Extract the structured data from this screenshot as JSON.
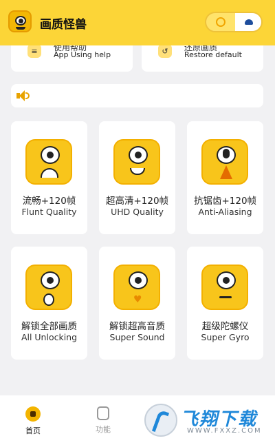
{
  "app": {
    "title": "画质怪兽"
  },
  "top_cards": [
    {
      "cn": "使用帮助",
      "en": "App Using help",
      "icon": "layers-icon"
    },
    {
      "cn": "还原画质",
      "en": "Restore default",
      "icon": "restore-icon"
    }
  ],
  "features": [
    {
      "cn": "流畅+120帧",
      "en": "Flunt Quality",
      "mouth": "sad"
    },
    {
      "cn": "超高清+120帧",
      "en": "UHD Quality",
      "mouth": "smile"
    },
    {
      "cn": "抗锯齿+120帧",
      "en": "Anti-Aliasing",
      "mouth": "triangle"
    },
    {
      "cn": "解锁全部画质",
      "en": "All Unlocking",
      "mouth": "o"
    },
    {
      "cn": "解锁超高音质",
      "en": "Super Sound",
      "mouth": "heart"
    },
    {
      "cn": "超级陀螺仪",
      "en": "Super Gyro",
      "mouth": "flat"
    }
  ],
  "tabs": [
    {
      "label": "首页",
      "active": true
    },
    {
      "label": "功能",
      "active": false
    }
  ],
  "watermark": {
    "brand": "飞翔下载",
    "url": "WWW.FXXZ.COM"
  },
  "colors": {
    "accent": "#fcd537",
    "face": "#f8c51b",
    "background": "#f1f1f3"
  }
}
